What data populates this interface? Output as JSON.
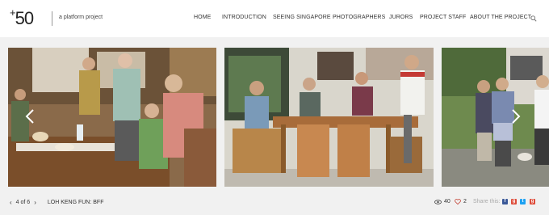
{
  "header": {
    "logo_text": "50",
    "logo_plus": "+",
    "tagline": "a platform project",
    "nav": [
      {
        "label": "HOME"
      },
      {
        "label": "INTRODUCTION"
      },
      {
        "label": "SEEING SINGAPORE"
      },
      {
        "label": "PHOTOGRAPHERS"
      },
      {
        "label": "JURORS"
      },
      {
        "label": "PROJECT STAFF"
      },
      {
        "label": "ABOUT THE PROJECT"
      }
    ]
  },
  "gallery": {
    "photos": [
      "photo-1",
      "photo-2",
      "photo-3"
    ]
  },
  "footer": {
    "counter": "4 of 6",
    "title": "LOH KENG FUN: BFF",
    "views": "40",
    "likes": "2",
    "share_label": "Share this:",
    "social": [
      {
        "name": "facebook",
        "glyph": "f",
        "color": "#3b5998"
      },
      {
        "name": "google-plus",
        "glyph": "g",
        "color": "#dd4b39"
      },
      {
        "name": "twitter",
        "glyph": "t",
        "color": "#1da1f2"
      },
      {
        "name": "google-plus",
        "glyph": "g",
        "color": "#dd4b39"
      }
    ]
  },
  "colors": {
    "background": "#f1f1f1",
    "heart": "#c0392b"
  }
}
